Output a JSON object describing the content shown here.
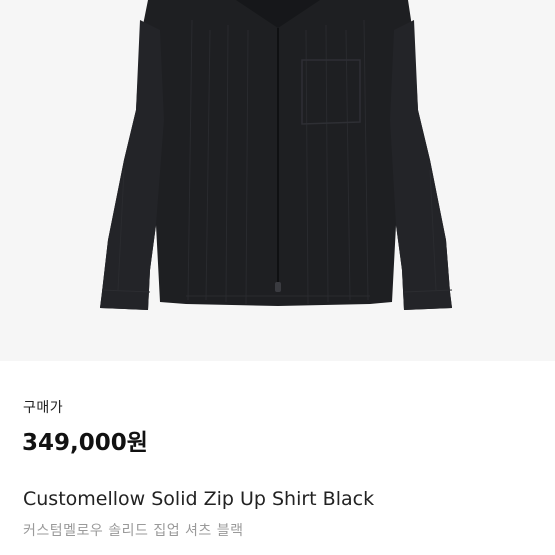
{
  "product": {
    "image_name": "black-zip-up-shirt-photo",
    "price_caption": "구매가",
    "price": "349,000원",
    "name_en": "Customellow Solid Zip Up Shirt Black",
    "name_ko": "커스텀멜로우 솔리드 집업 셔츠 블랙"
  },
  "colors": {
    "photo_background": "#f6f6f6",
    "garment": "#1e1f22",
    "price_text": "#111111",
    "subtitle_text": "#9a9a9a"
  }
}
